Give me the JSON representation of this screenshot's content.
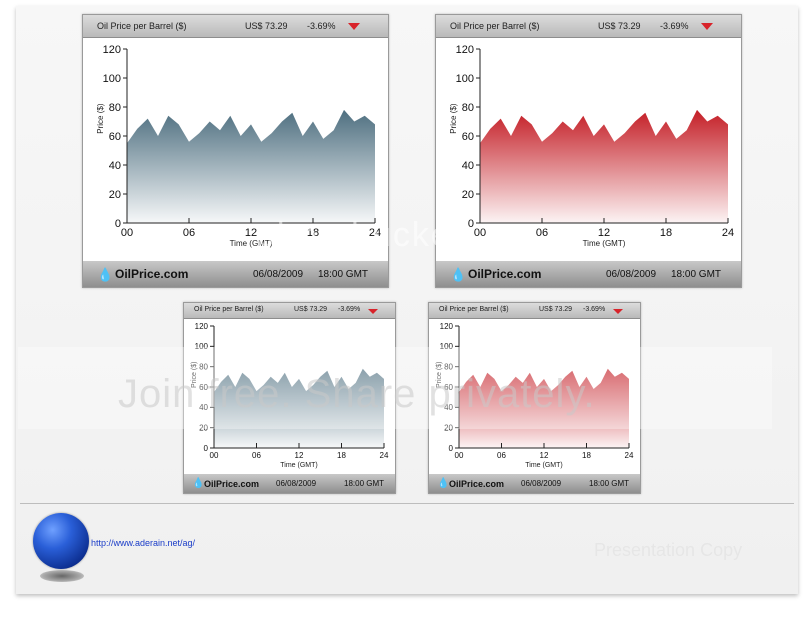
{
  "widgets": [
    {
      "title": "Oil Price per Barrel ($)",
      "price": "US$ 73.29",
      "change": "-3.69%",
      "logo": "OilPrice.com",
      "date": "06/08/2009",
      "time": "18:00 GMT",
      "chart_data": {
        "type": "area",
        "title": "Oil Price per Barrel ($)",
        "xlabel": "Time (GMT)",
        "ylabel": "Price ($)",
        "x_ticks": [
          "00",
          "06",
          "12",
          "18",
          "24"
        ],
        "y_ticks": [
          "0",
          "20",
          "40",
          "60",
          "80",
          "100",
          "120"
        ],
        "xlim": [
          0,
          24
        ],
        "ylim": [
          0,
          120
        ],
        "series": [
          {
            "color": "#4e6f80",
            "x": [
              0,
              1,
              2,
              3,
              4,
              5,
              6,
              7,
              8,
              9,
              10,
              11,
              12,
              13,
              14,
              15,
              16,
              17,
              18,
              19,
              20,
              21,
              22,
              23,
              24
            ],
            "values": [
              55,
              65,
              72,
              60,
              74,
              68,
              56,
              62,
              70,
              64,
              74,
              60,
              68,
              56,
              62,
              70,
              76,
              60,
              70,
              58,
              64,
              78,
              70,
              74,
              68
            ]
          }
        ]
      }
    },
    {
      "title": "Oil Price per Barrel ($)",
      "price": "US$ 73.29",
      "change": "-3.69%",
      "logo": "OilPrice.com",
      "date": "06/08/2009",
      "time": "18:00 GMT",
      "chart_data": {
        "type": "area",
        "title": "Oil Price per Barrel ($)",
        "xlabel": "Time (GMT)",
        "ylabel": "Price ($)",
        "x_ticks": [
          "00",
          "06",
          "12",
          "18",
          "24"
        ],
        "y_ticks": [
          "0",
          "20",
          "40",
          "60",
          "80",
          "100",
          "120"
        ],
        "xlim": [
          0,
          24
        ],
        "ylim": [
          0,
          120
        ],
        "series": [
          {
            "color": "#c41e26",
            "x": [
              0,
              1,
              2,
              3,
              4,
              5,
              6,
              7,
              8,
              9,
              10,
              11,
              12,
              13,
              14,
              15,
              16,
              17,
              18,
              19,
              20,
              21,
              22,
              23,
              24
            ],
            "values": [
              55,
              65,
              72,
              60,
              74,
              68,
              56,
              62,
              70,
              64,
              74,
              60,
              68,
              56,
              62,
              70,
              76,
              60,
              70,
              58,
              64,
              78,
              70,
              74,
              68
            ]
          }
        ]
      }
    },
    {
      "title": "Oil Price per Barrel ($)",
      "price": "US$ 73.29",
      "change": "-3.69%",
      "logo": "OilPrice.com",
      "date": "06/08/2009",
      "time": "18:00 GMT",
      "chart_data": {
        "type": "area",
        "title": "Oil Price per Barrel ($)",
        "xlabel": "Time (GMT)",
        "ylabel": "Price ($)",
        "x_ticks": [
          "00",
          "06",
          "12",
          "18",
          "24"
        ],
        "y_ticks": [
          "0",
          "20",
          "40",
          "60",
          "80",
          "100",
          "120"
        ],
        "xlim": [
          0,
          24
        ],
        "ylim": [
          0,
          120
        ],
        "series": [
          {
            "color": "#4e6f80",
            "x": [
              0,
              1,
              2,
              3,
              4,
              5,
              6,
              7,
              8,
              9,
              10,
              11,
              12,
              13,
              14,
              15,
              16,
              17,
              18,
              19,
              20,
              21,
              22,
              23,
              24
            ],
            "values": [
              55,
              65,
              72,
              60,
              74,
              68,
              56,
              62,
              70,
              64,
              74,
              60,
              68,
              56,
              62,
              70,
              76,
              60,
              70,
              58,
              64,
              78,
              70,
              74,
              68
            ]
          }
        ]
      }
    },
    {
      "title": "Oil Price per Barrel ($)",
      "price": "US$ 73.29",
      "change": "-3.69%",
      "logo": "OilPrice.com",
      "date": "06/08/2009",
      "time": "18:00 GMT",
      "chart_data": {
        "type": "area",
        "title": "Oil Price per Barrel ($)",
        "xlabel": "Time (GMT)",
        "ylabel": "Price ($)",
        "x_ticks": [
          "00",
          "06",
          "12",
          "18",
          "24"
        ],
        "y_ticks": [
          "0",
          "20",
          "40",
          "60",
          "80",
          "100",
          "120"
        ],
        "xlim": [
          0,
          24
        ],
        "ylim": [
          0,
          120
        ],
        "series": [
          {
            "color": "#c41e26",
            "x": [
              0,
              1,
              2,
              3,
              4,
              5,
              6,
              7,
              8,
              9,
              10,
              11,
              12,
              13,
              14,
              15,
              16,
              17,
              18,
              19,
              20,
              21,
              22,
              23,
              24
            ],
            "values": [
              55,
              65,
              72,
              60,
              74,
              68,
              56,
              62,
              70,
              64,
              74,
              60,
              68,
              56,
              62,
              70,
              76,
              60,
              70,
              58,
              64,
              78,
              70,
              74,
              68
            ]
          }
        ]
      }
    }
  ],
  "footer": {
    "url": "http://www.aderain.net/ag/",
    "presentation_label": "Presentation Copy"
  },
  "watermark": {
    "line1": "photobucket",
    "line2": "Join free. Share privately."
  }
}
